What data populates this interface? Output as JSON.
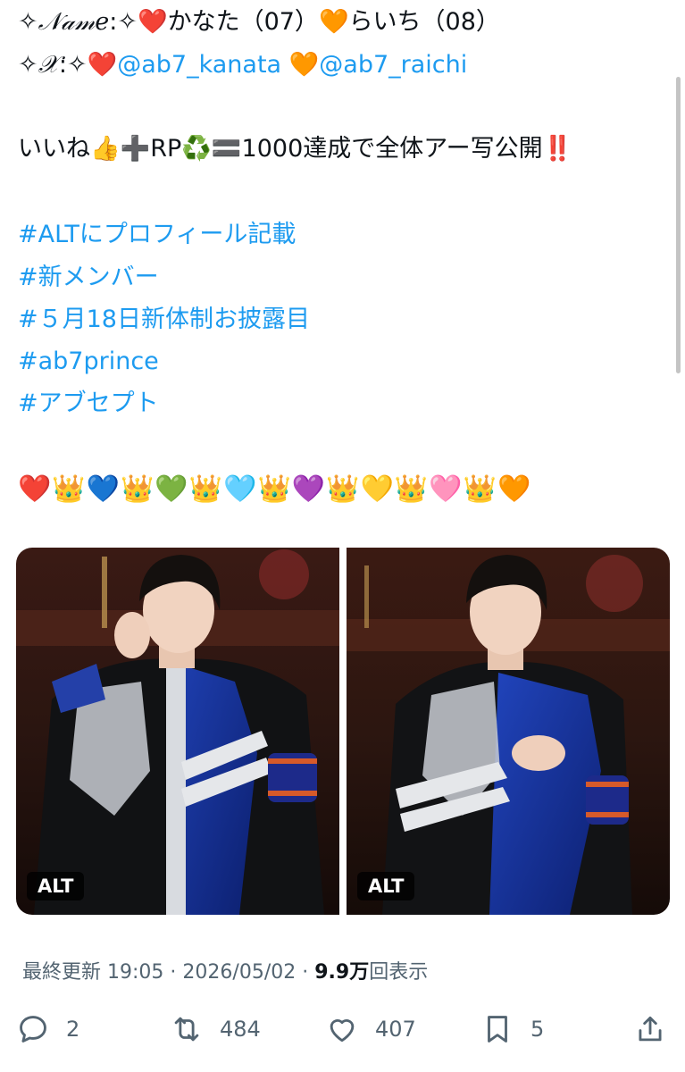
{
  "tweet": {
    "name_line": {
      "sparkle": "✧",
      "label": "𝒩𝒶𝓂𝑒",
      "sep": ":",
      "heart_red": "❤️",
      "member1": "かなた（07）",
      "heart_orange": "🧡",
      "member2": "らいち（08）"
    },
    "x_line": {
      "sparkle": "✧",
      "label": "𝒳",
      "sep": ":",
      "heart_red": "❤️",
      "handle1": "@ab7_kanata",
      "heart_orange": "🧡",
      "handle2": "@ab7_raichi"
    },
    "goal_line": {
      "text1": "いいね",
      "thumbs": "👍",
      "plus": "➕",
      "rp": "RP",
      "recycle": "♻️",
      "equals": "🟰",
      "text2": "1000達成で全体アー写公開",
      "exclaim": "‼️"
    },
    "hashtags": [
      "#ALTにプロフィール記載",
      "#新メンバー",
      "#５月18日新体制お披露目",
      "#ab7prince",
      "#アブセプト"
    ],
    "emoji_row": "❤️👑💙👑💚👑🩵👑💜👑💛👑🩷👑🧡",
    "images": [
      {
        "alt_badge": "ALT"
      },
      {
        "alt_badge": "ALT"
      }
    ],
    "meta": {
      "updated_label": "最終更新",
      "time": "19:05",
      "dot1": "·",
      "date": "2026/05/02",
      "dot2": "·",
      "views_value": "9.9万",
      "views_label": "回表示"
    },
    "actions": {
      "replies": "2",
      "reposts": "484",
      "likes": "407",
      "bookmarks": "5"
    }
  },
  "colors": {
    "link": "#1d9bf0",
    "muted": "#536471",
    "text": "#0f1419"
  },
  "icons": [
    "reply-icon",
    "repost-icon",
    "like-icon",
    "bookmark-icon",
    "share-icon"
  ]
}
